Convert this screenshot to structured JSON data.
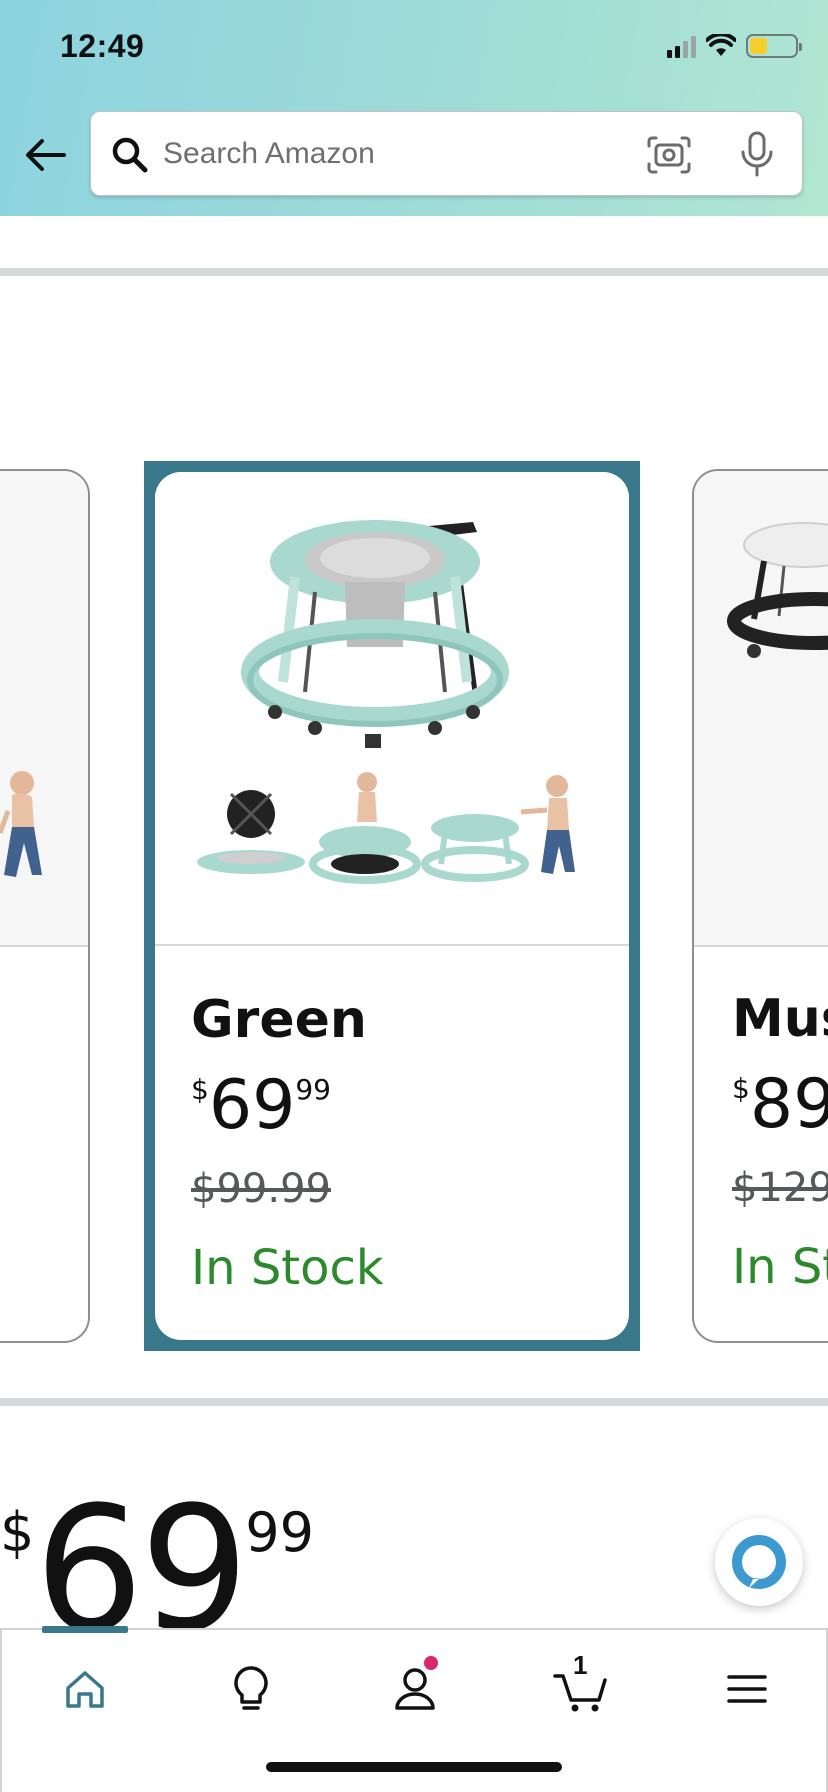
{
  "status_bar": {
    "time": "12:49"
  },
  "search": {
    "placeholder": "Search Amazon"
  },
  "products": {
    "selected": {
      "name": "Green",
      "price_symbol": "$",
      "price_whole": "69",
      "price_fraction": "99",
      "old_price": "$99.99",
      "stock": "In Stock"
    },
    "right": {
      "name": "Mus",
      "price_symbol": "$",
      "price_whole": "89",
      "old_price": "$129",
      "stock": "In St"
    }
  },
  "summary_price": {
    "symbol": "$",
    "whole": "69",
    "fraction": "99"
  },
  "bottom_nav": {
    "cart_count": "1"
  },
  "colors": {
    "accent": "#38788a",
    "in_stock": "#2c8a2c",
    "notification": "#d9266f"
  }
}
